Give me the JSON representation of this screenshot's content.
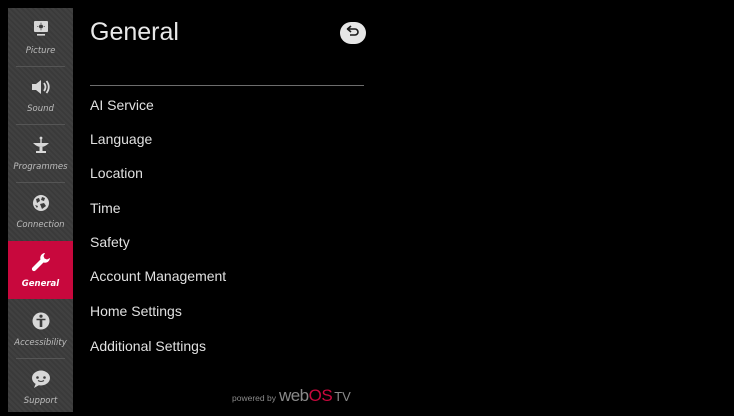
{
  "sidebar": {
    "items": [
      {
        "label": "Picture",
        "icon": "picture-icon"
      },
      {
        "label": "Sound",
        "icon": "speaker-icon"
      },
      {
        "label": "Programmes",
        "icon": "satellite-dish-icon"
      },
      {
        "label": "Connection",
        "icon": "globe-icon"
      },
      {
        "label": "General",
        "icon": "wrench-icon",
        "active": true
      },
      {
        "label": "Accessibility",
        "icon": "accessibility-icon"
      },
      {
        "label": "Support",
        "icon": "support-icon"
      }
    ]
  },
  "header": {
    "title": "General",
    "back_icon": "back-arrow-icon"
  },
  "menu": {
    "items": [
      "AI Service",
      "Language",
      "Location",
      "Time",
      "Safety",
      "Account Management",
      "Home Settings",
      "Additional Settings"
    ]
  },
  "footer": {
    "powered_by": "powered by",
    "brand_web": "web",
    "brand_os": "OS",
    "brand_tv": "TV"
  },
  "colors": {
    "accent": "#c8083d",
    "sidebar_bg": "#3c3c3c",
    "background": "#000000"
  }
}
